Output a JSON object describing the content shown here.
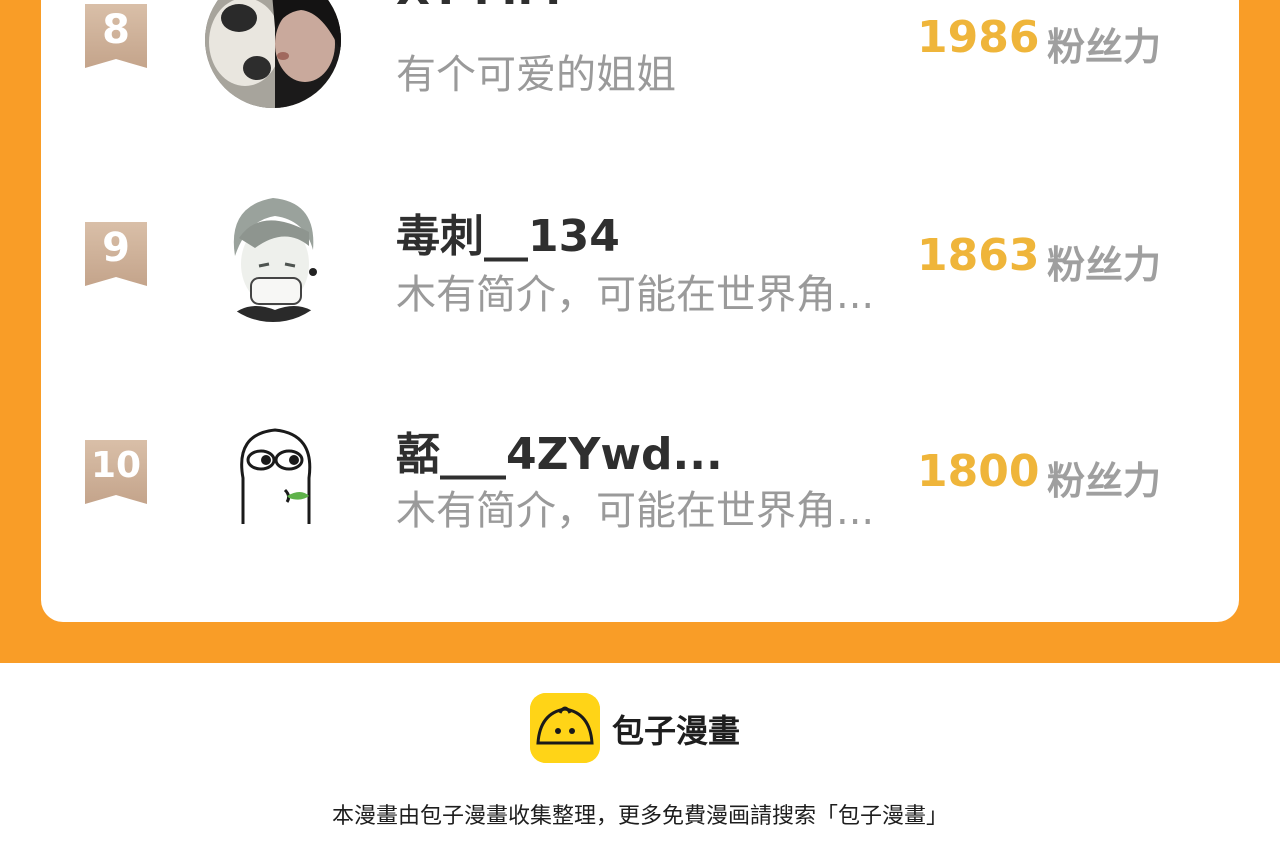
{
  "ranking": {
    "entries": [
      {
        "rank": "8",
        "name": "XY-MM",
        "bio": "有个可爱的姐姐",
        "score": "1986",
        "unit": "粉丝力",
        "avatar": "cat-and-girl-avatar"
      },
      {
        "rank": "9",
        "name": "毒刺__134",
        "bio": "木有简介，可能在世界角...",
        "score": "1863",
        "unit": "粉丝力",
        "avatar": "masked-boy-avatar"
      },
      {
        "rank": "10",
        "name": "嚭___4ZYwd...",
        "bio": "木有简介，可能在世界角...",
        "score": "1800",
        "unit": "粉丝力",
        "avatar": "doodle-face-avatar"
      }
    ]
  },
  "brand": {
    "name": "包子漫畫",
    "logo_icon": "bun-logo-icon",
    "note": "本漫畫由包子漫畫收集整理，更多免費漫画請搜索「包子漫畫」"
  },
  "colors": {
    "accent": "#f99d27",
    "score": "#efb53a",
    "logo": "#ffd417"
  }
}
